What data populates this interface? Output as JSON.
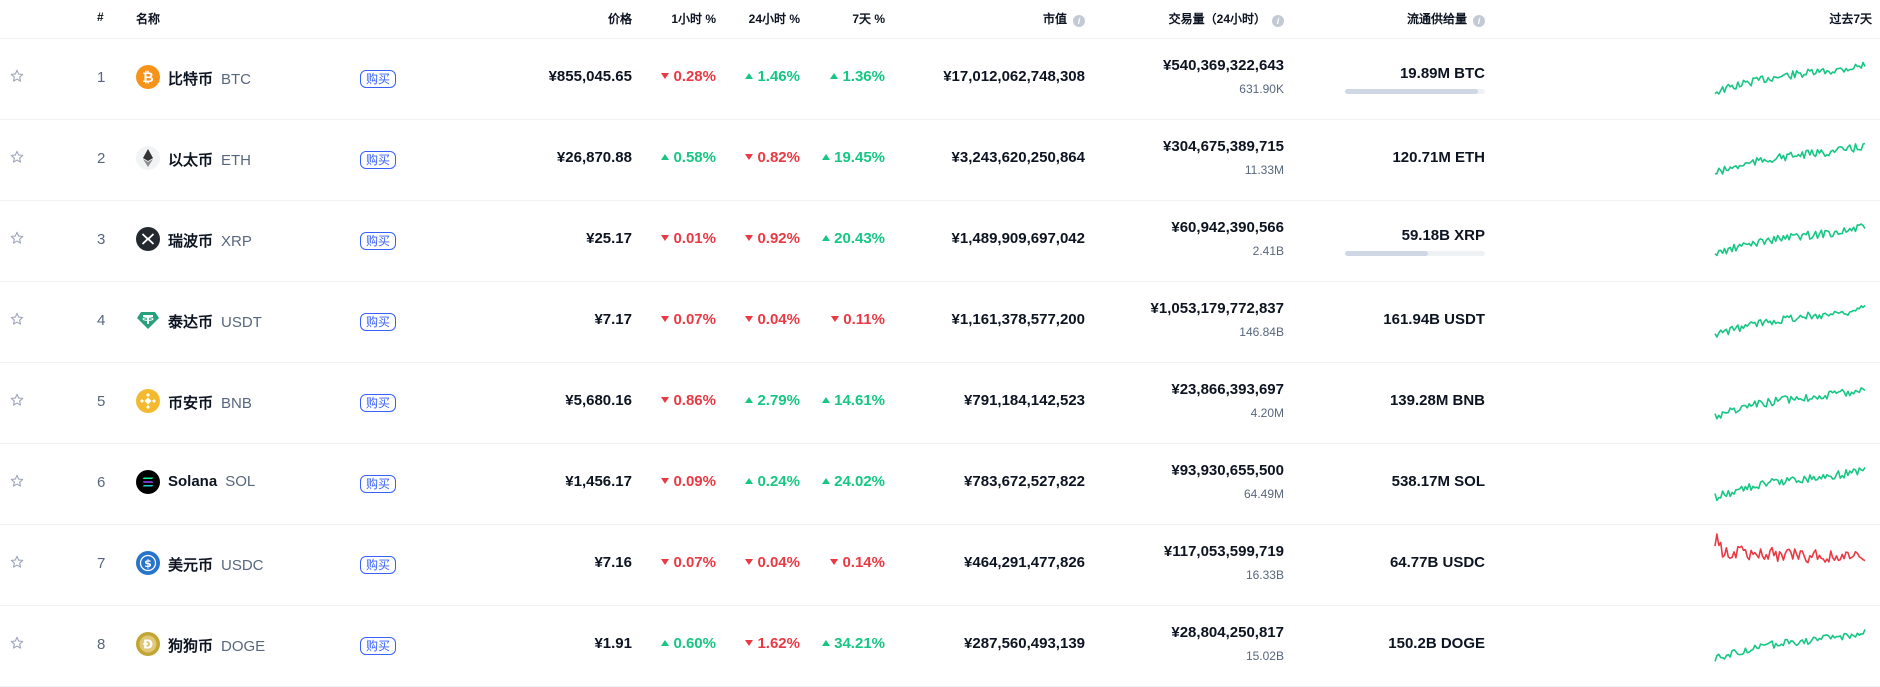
{
  "headers": {
    "rank": "#",
    "name": "名称",
    "price": "价格",
    "h1": "1小时 %",
    "h24": "24小时 %",
    "d7": "7天 %",
    "mcap": "市值",
    "volume": "交易量（24小时）",
    "supply": "流通供给量",
    "last7": "过去7天"
  },
  "buy_label": "购买",
  "rows": [
    {
      "rank": "1",
      "name": "比特币",
      "symbol": "BTC",
      "icon": "bitcoin-icon",
      "price": "¥855,045.65",
      "h1": "0.28%",
      "h1_dir": "down",
      "h24": "1.46%",
      "h24_dir": "up",
      "d7": "1.36%",
      "d7_dir": "up",
      "mcap": "¥17,012,062,748,308",
      "volume": "¥540,369,322,643",
      "volume_coin": "631.90K",
      "supply": "19.89M BTC",
      "supply_fraction": 0.95,
      "spark_trend": "up"
    },
    {
      "rank": "2",
      "name": "以太币",
      "symbol": "ETH",
      "icon": "ethereum-icon",
      "price": "¥26,870.88",
      "h1": "0.58%",
      "h1_dir": "up",
      "h24": "0.82%",
      "h24_dir": "down",
      "d7": "19.45%",
      "d7_dir": "up",
      "mcap": "¥3,243,620,250,864",
      "volume": "¥304,675,389,715",
      "volume_coin": "11.33M",
      "supply": "120.71M ETH",
      "supply_fraction": null,
      "spark_trend": "up"
    },
    {
      "rank": "3",
      "name": "瑞波币",
      "symbol": "XRP",
      "icon": "xrp-icon",
      "price": "¥25.17",
      "h1": "0.01%",
      "h1_dir": "down",
      "h24": "0.92%",
      "h24_dir": "down",
      "d7": "20.43%",
      "d7_dir": "up",
      "mcap": "¥1,489,909,697,042",
      "volume": "¥60,942,390,566",
      "volume_coin": "2.41B",
      "supply": "59.18B XRP",
      "supply_fraction": 0.59,
      "spark_trend": "up"
    },
    {
      "rank": "4",
      "name": "泰达币",
      "symbol": "USDT",
      "icon": "tether-icon",
      "price": "¥7.17",
      "h1": "0.07%",
      "h1_dir": "down",
      "h24": "0.04%",
      "h24_dir": "down",
      "d7": "0.11%",
      "d7_dir": "down",
      "mcap": "¥1,161,378,577,200",
      "volume": "¥1,053,179,772,837",
      "volume_coin": "146.84B",
      "supply": "161.94B USDT",
      "supply_fraction": null,
      "spark_trend": "up"
    },
    {
      "rank": "5",
      "name": "币安币",
      "symbol": "BNB",
      "icon": "bnb-icon",
      "price": "¥5,680.16",
      "h1": "0.86%",
      "h1_dir": "down",
      "h24": "2.79%",
      "h24_dir": "up",
      "d7": "14.61%",
      "d7_dir": "up",
      "mcap": "¥791,184,142,523",
      "volume": "¥23,866,393,697",
      "volume_coin": "4.20M",
      "supply": "139.28M BNB",
      "supply_fraction": null,
      "spark_trend": "up"
    },
    {
      "rank": "6",
      "name": "Solana",
      "symbol": "SOL",
      "icon": "solana-icon",
      "price": "¥1,456.17",
      "h1": "0.09%",
      "h1_dir": "down",
      "h24": "0.24%",
      "h24_dir": "up",
      "d7": "24.02%",
      "d7_dir": "up",
      "mcap": "¥783,672,527,822",
      "volume": "¥93,930,655,500",
      "volume_coin": "64.49M",
      "supply": "538.17M SOL",
      "supply_fraction": null,
      "spark_trend": "up"
    },
    {
      "rank": "7",
      "name": "美元币",
      "symbol": "USDC",
      "icon": "usdc-icon",
      "price": "¥7.16",
      "h1": "0.07%",
      "h1_dir": "down",
      "h24": "0.04%",
      "h24_dir": "down",
      "d7": "0.14%",
      "d7_dir": "down",
      "mcap": "¥464,291,477,826",
      "volume": "¥117,053,599,719",
      "volume_coin": "16.33B",
      "supply": "64.77B USDC",
      "supply_fraction": null,
      "spark_trend": "down"
    },
    {
      "rank": "8",
      "name": "狗狗币",
      "symbol": "DOGE",
      "icon": "dogecoin-icon",
      "price": "¥1.91",
      "h1": "0.60%",
      "h1_dir": "up",
      "h24": "1.62%",
      "h24_dir": "down",
      "d7": "34.21%",
      "d7_dir": "up",
      "mcap": "¥287,560,493,139",
      "volume": "¥28,804,250,817",
      "volume_coin": "15.02B",
      "supply": "150.2B DOGE",
      "supply_fraction": null,
      "spark_trend": "up"
    }
  ],
  "colors": {
    "up": "#16c784",
    "down": "#ea3943",
    "accent": "#3861fb",
    "bitcoin": "#f7931a",
    "tether": "#26a17b",
    "bnb": "#f3ba2f",
    "usdc": "#2775ca",
    "doge": "#c2a633"
  }
}
